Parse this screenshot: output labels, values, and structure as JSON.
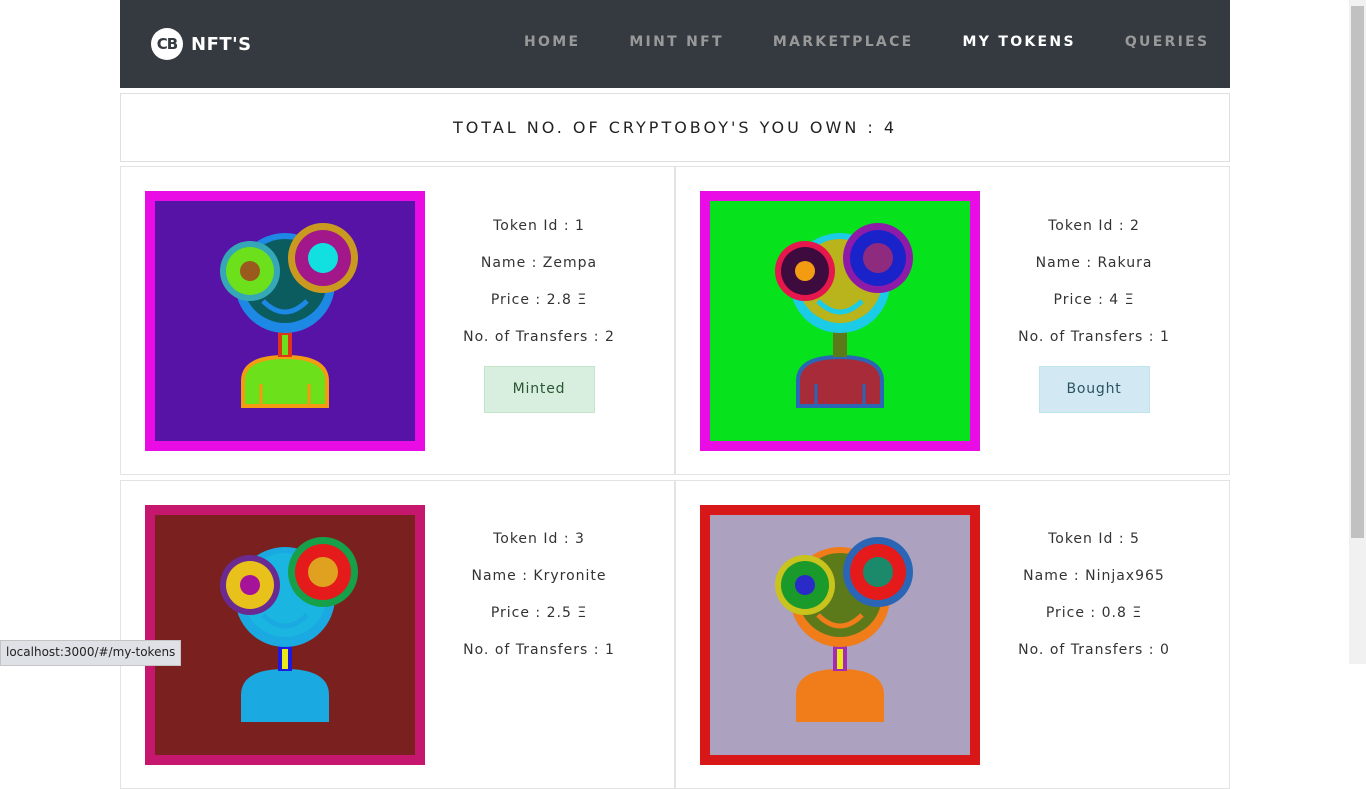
{
  "brand": {
    "logo_text": "CB",
    "name": "NFT'S"
  },
  "nav": {
    "items": [
      {
        "label": "HOME",
        "active": false
      },
      {
        "label": "MINT NFT",
        "active": false
      },
      {
        "label": "MARKETPLACE",
        "active": false
      },
      {
        "label": "MY TOKENS",
        "active": true
      },
      {
        "label": "QUERIES",
        "active": false
      }
    ]
  },
  "summary": {
    "text": "TOTAL NO. OF CRYPTOBOY'S YOU OWN : 4"
  },
  "tokens": [
    {
      "id_text": "Token Id : 1",
      "name_text": "Name : Zempa",
      "price_text": "Price : 2.8 Ξ",
      "transfers_text": "No. of Transfers : 2",
      "status": "Minted",
      "colors": {
        "border": "#ea0ce4",
        "bg": "#5712a6",
        "face": "#1e88e5",
        "face_inner": "#0b5c5f",
        "eye_left_ring": "#35a7b6",
        "eye_left": "#6be01b",
        "pupil_left": "#9a5a1e",
        "eye_right_ring": "#c99a1f",
        "eye_right": "#a2178a",
        "pupil_right": "#12e0e0",
        "neck": "#e0341a",
        "neck_inner": "#6be01b",
        "body": "#6be01b",
        "body_trim": "#f39c12"
      }
    },
    {
      "id_text": "Token Id : 2",
      "name_text": "Name : Rakura",
      "price_text": "Price : 4 Ξ",
      "transfers_text": "No. of Transfers : 1",
      "status": "Bought",
      "colors": {
        "border": "#ea0ce4",
        "bg": "#06e21c",
        "face": "#1ccbe5",
        "face_inner": "#b9b31c",
        "eye_left_ring": "#e6174d",
        "eye_left": "#3d0b3e",
        "pupil_left": "#f39c12",
        "eye_right_ring": "#8e1ba8",
        "eye_right": "#1a22c9",
        "pupil_right": "#8e2b7f",
        "neck": "#5d7a1a",
        "neck_inner": "#5d7a1a",
        "body": "#a82b3a",
        "body_trim": "#2a66b5"
      }
    },
    {
      "id_text": "Token Id : 3",
      "name_text": "Name : Kryronite",
      "price_text": "Price : 2.5 Ξ",
      "transfers_text": "No. of Transfers : 1",
      "status": "",
      "colors": {
        "border": "#c5176d",
        "bg": "#7a2120",
        "face": "#1aa9e0",
        "face_inner": "#1ab5e0",
        "eye_left_ring": "#6a2a91",
        "eye_left": "#e8c21b",
        "pupil_left": "#a5139a",
        "eye_right_ring": "#17a04a",
        "eye_right": "#e51a1a",
        "pupil_right": "#e0a020",
        "neck": "#1a1ae0",
        "neck_inner": "#e8e81b",
        "body": "#1aa9e0",
        "body_trim": "#1aa9e0"
      }
    },
    {
      "id_text": "Token Id : 5",
      "name_text": "Name : Ninjax965",
      "price_text": "Price : 0.8 Ξ",
      "transfers_text": "No. of Transfers : 0",
      "status": "",
      "colors": {
        "border": "#d81818",
        "bg": "#aca2c0",
        "face": "#f07c1a",
        "face_inner": "#5d7a1a",
        "eye_left_ring": "#c9c31e",
        "eye_left": "#1a9a2a",
        "pupil_left": "#2a2ac9",
        "eye_right_ring": "#2a66b5",
        "eye_right": "#e51a1a",
        "pupil_right": "#1a8a6a",
        "neck": "#a52bb5",
        "neck_inner": "#e8e81b",
        "body": "#f07c1a",
        "body_trim": "#f07c1a"
      }
    }
  ],
  "status_bar": {
    "url": "localhost:3000/#/my-tokens"
  }
}
